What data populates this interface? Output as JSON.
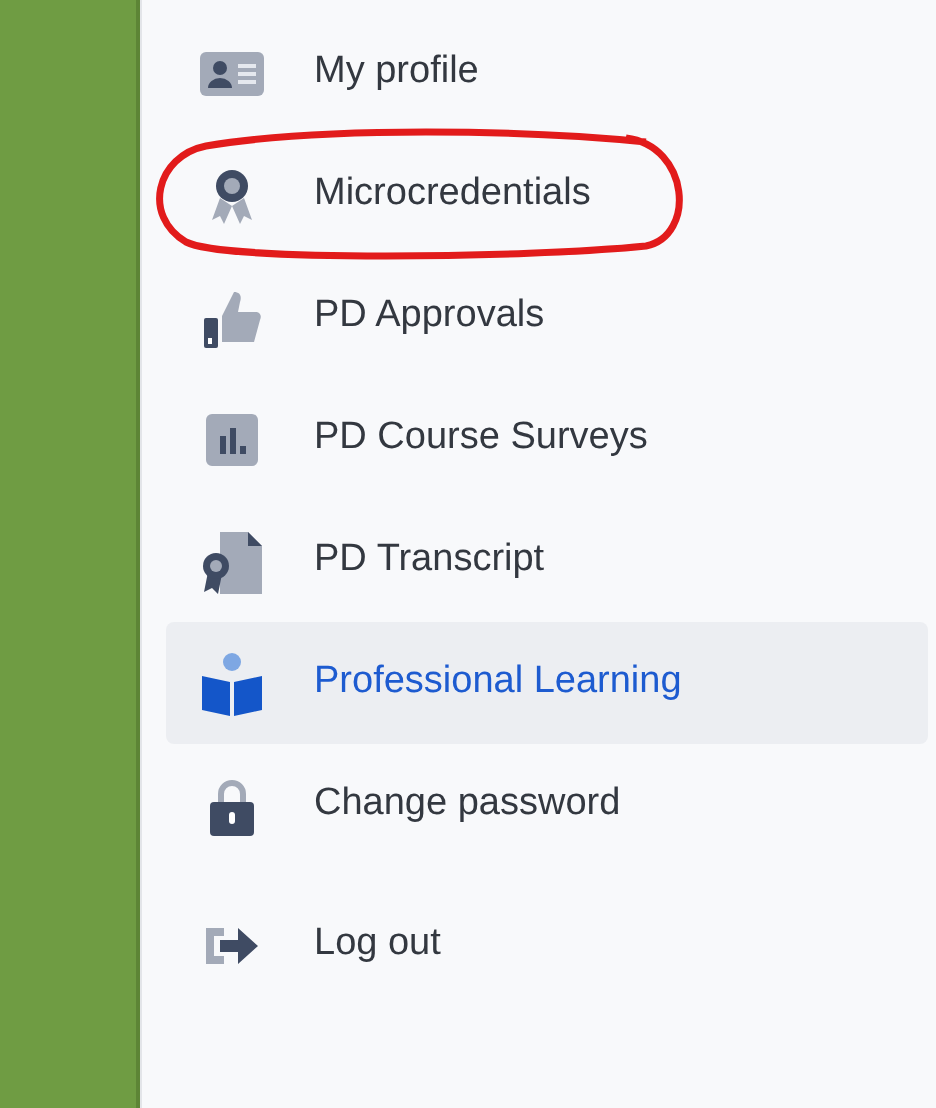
{
  "menu": {
    "items": [
      {
        "label": "My profile",
        "kind": "profile",
        "selected": false
      },
      {
        "label": "Microcredentials",
        "kind": "badge",
        "selected": false,
        "circled": true
      },
      {
        "label": "PD Approvals",
        "kind": "approval",
        "selected": false
      },
      {
        "label": "PD Course Surveys",
        "kind": "survey",
        "selected": false
      },
      {
        "label": "PD Transcript",
        "kind": "transcript",
        "selected": false
      },
      {
        "label": "Professional Learning",
        "kind": "learning",
        "selected": true
      },
      {
        "label": "Change password",
        "kind": "password",
        "selected": false
      },
      {
        "label": "Log out",
        "kind": "logout",
        "selected": false
      }
    ]
  }
}
